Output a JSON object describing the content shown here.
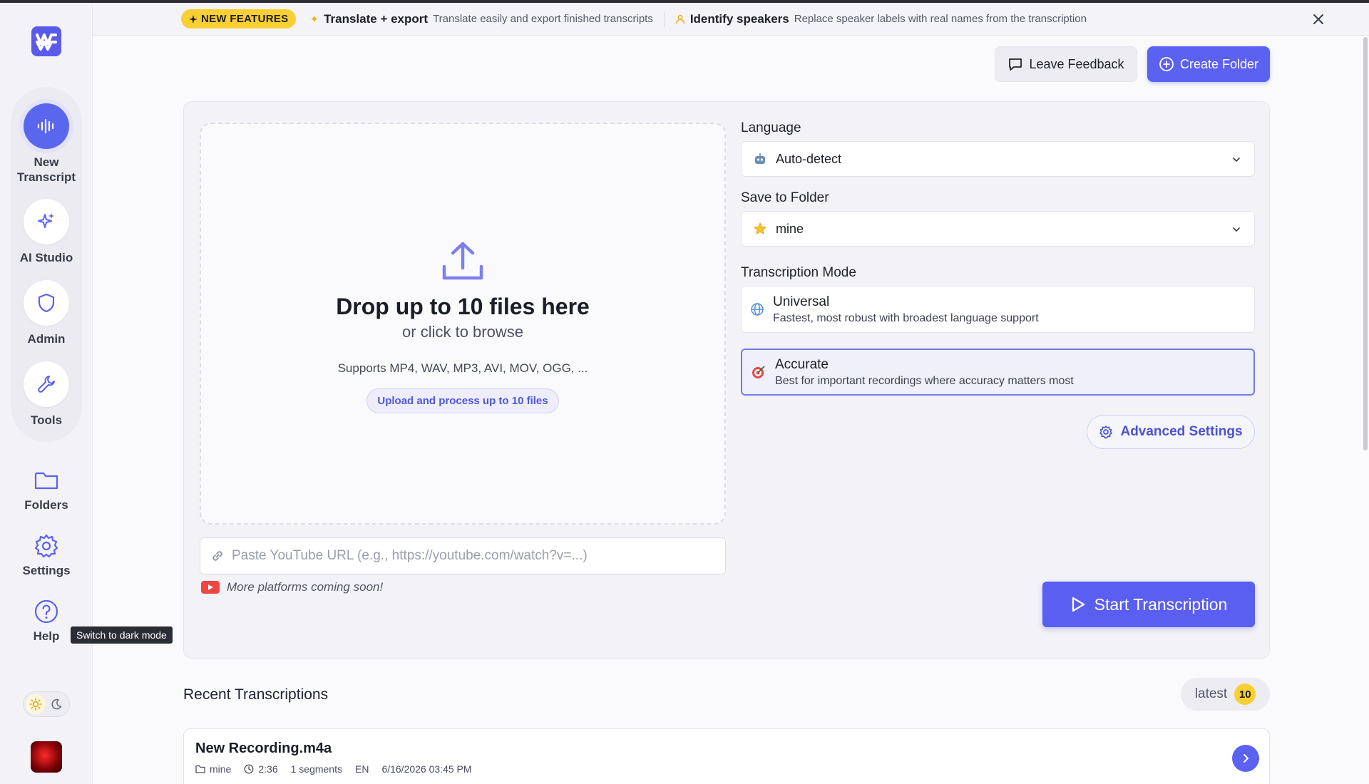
{
  "banner": {
    "badge": "NEW FEATURES",
    "features": [
      {
        "title": "Translate + export",
        "desc": "Translate easily and export finished transcripts"
      },
      {
        "title": "Identify speakers",
        "desc": "Replace speaker labels with real names from the transcription"
      }
    ]
  },
  "sidebar": {
    "items": [
      {
        "label": "New Transcript",
        "icon": "waveform-icon"
      },
      {
        "label": "AI Studio",
        "icon": "sparkle-icon"
      },
      {
        "label": "Admin",
        "icon": "shield-icon"
      },
      {
        "label": "Tools",
        "icon": "wrench-icon"
      },
      {
        "label": "Folders",
        "icon": "folder-icon"
      },
      {
        "label": "Settings",
        "icon": "gear-icon"
      },
      {
        "label": "Help",
        "icon": "help-icon"
      }
    ],
    "tooltip": "Switch to dark mode"
  },
  "header": {
    "feedback_label": "Leave Feedback",
    "create_folder_label": "Create Folder"
  },
  "upload": {
    "title": "Drop up to 10 files here",
    "subtitle": "or click to browse",
    "supports": "Supports MP4, WAV, MP3, AVI, MOV, OGG, ...",
    "chip": "Upload and process up to 10 files",
    "url_placeholder": "Paste YouTube URL (e.g., https://youtube.com/watch?v=...)",
    "platforms_note": "More platforms coming soon!"
  },
  "options": {
    "language_label": "Language",
    "language_value": "Auto-detect",
    "folder_label": "Save to Folder",
    "folder_value": "mine",
    "mode_label": "Transcription Mode",
    "modes": [
      {
        "title": "Universal",
        "desc": "Fastest, most robust with broadest language support",
        "selected": false
      },
      {
        "title": "Accurate",
        "desc": "Best for important recordings where accuracy matters most",
        "selected": true
      }
    ],
    "advanced_label": "Advanced Settings",
    "start_label": "Start Transcription"
  },
  "recent": {
    "title": "Recent Transcriptions",
    "sort_label": "latest",
    "count": "10",
    "items": [
      {
        "name": "New Recording.m4a",
        "folder": "mine",
        "duration": "2:36",
        "segments": "1 segments",
        "lang": "EN",
        "date": "6/16/2026 03:45 PM"
      }
    ]
  },
  "colors": {
    "accent": "#5b61f0",
    "badge": "#f9cf34"
  }
}
